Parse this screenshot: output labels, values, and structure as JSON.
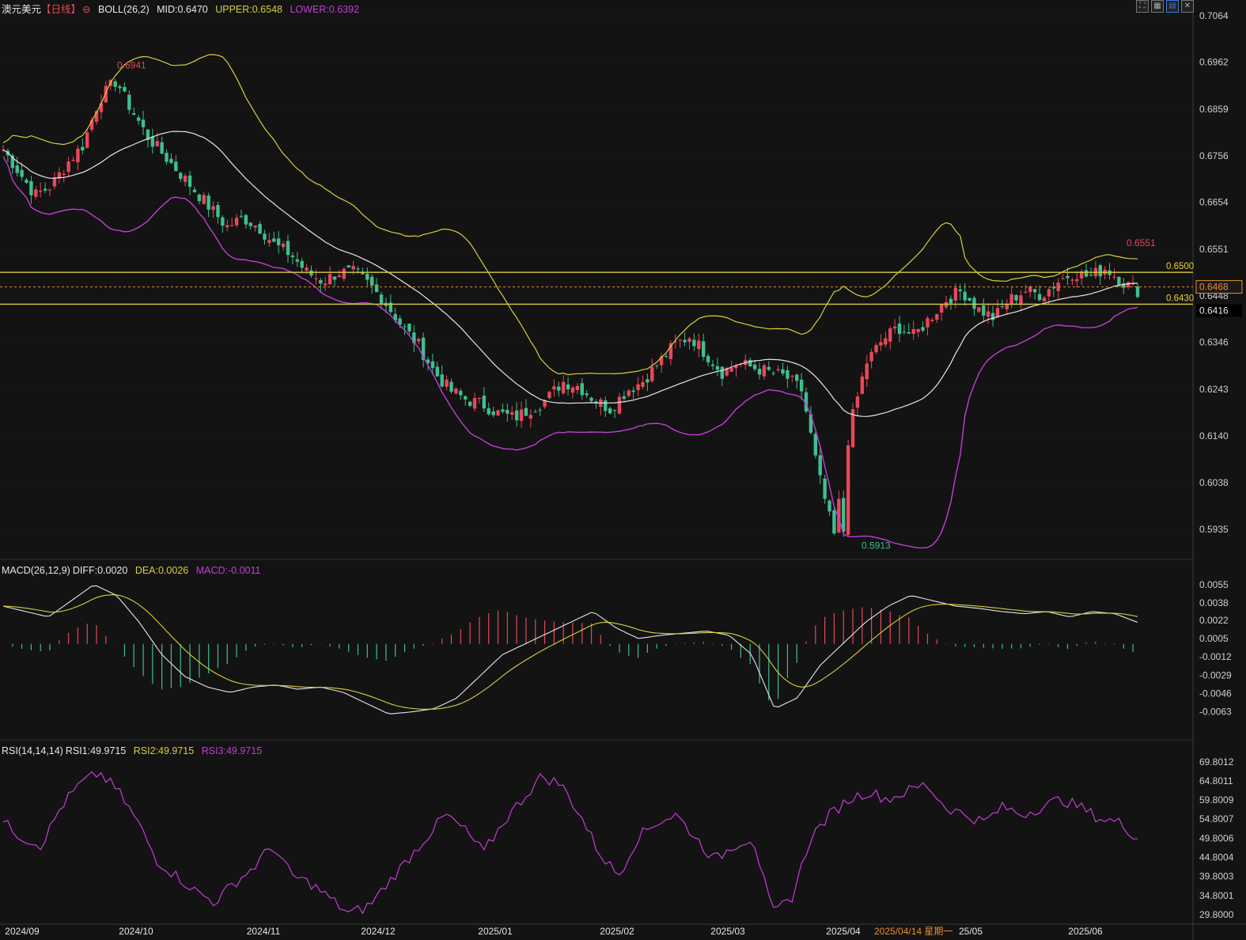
{
  "header": {
    "symbol": "澳元美元",
    "period": "【日线】",
    "indicator": "BOLL(26,2)",
    "mid": "MID:0.6470",
    "upper": "UPPER:0.6548",
    "lower": "LOWER:0.6392"
  },
  "toolbar_icons": [
    "fullscreen-icon",
    "grid-icon",
    "layout-icon",
    "close-icon"
  ],
  "colors": {
    "up": "#e8475a",
    "down": "#3fbf8f",
    "mid": "#e6e6e6",
    "upper": "#d8cf3a",
    "lower": "#c43cd6",
    "rsi": "#c43cd6"
  },
  "macd_header": {
    "title": "MACD(26,12,9)",
    "diff": "DIFF:0.0020",
    "dea": "DEA:0.0026",
    "macd": "MACD:-0.0011"
  },
  "rsi_header": {
    "title": "RSI(14,14,14)",
    "rsi1": "RSI1:49.9715",
    "rsi2": "RSI2:49.9715",
    "rsi3": "RSI3:49.9715"
  },
  "chart_data": {
    "type": "candlestick",
    "price_axis": {
      "ticks": [
        "0.7064",
        "0.6962",
        "0.6859",
        "0.6756",
        "0.6654",
        "0.6551",
        "0.6448",
        "0.6346",
        "0.6243",
        "0.6140",
        "0.6038",
        "0.5935"
      ],
      "ylim": [
        0.5895,
        0.7064
      ]
    },
    "macd_axis": {
      "ticks": [
        "0.0055",
        "0.0038",
        "0.0022",
        "0.0005",
        "-0.0012",
        "-0.0029",
        "-0.0046",
        "-0.0063"
      ]
    },
    "rsi_axis": {
      "ticks": [
        "69.8012",
        "64.8011",
        "59.8009",
        "54.8007",
        "49.8006",
        "44.8004",
        "39.8003",
        "34.8001",
        "29.8000"
      ]
    },
    "x_labels": [
      "2024/09",
      "2024/10",
      "2024/11",
      "2024/12",
      "2025/01",
      "2025/02",
      "2025/03",
      "2025/04",
      "25/05",
      "2025/06"
    ],
    "cursor_label": "2025/04/14 星期一",
    "horizontal_lines": [
      {
        "value": 0.65,
        "label": "0.6500"
      },
      {
        "value": 0.643,
        "label": "0.6430"
      }
    ],
    "current_price": "0.6468",
    "cursor_price": "0.6416",
    "annotations": {
      "high": "0.6941",
      "low": "0.5913",
      "recent_high": "0.6551"
    },
    "close_anchors": [
      0.677,
      0.672,
      0.667,
      0.669,
      0.674,
      0.678,
      0.688,
      0.692,
      0.686,
      0.68,
      0.676,
      0.672,
      0.668,
      0.664,
      0.66,
      0.662,
      0.66,
      0.656,
      0.654,
      0.65,
      0.648,
      0.65,
      0.65,
      0.647,
      0.643,
      0.638,
      0.634,
      0.628,
      0.624,
      0.622,
      0.621,
      0.619,
      0.618,
      0.62,
      0.622,
      0.626,
      0.625,
      0.622,
      0.62,
      0.624,
      0.626,
      0.63,
      0.634,
      0.636,
      0.632,
      0.628,
      0.63,
      0.629,
      0.628,
      0.627,
      0.624,
      0.606,
      0.592,
      0.616,
      0.63,
      0.635,
      0.638,
      0.636,
      0.64,
      0.644,
      0.646,
      0.642,
      0.64,
      0.644,
      0.646,
      0.645,
      0.648,
      0.65,
      0.649,
      0.651,
      0.648,
      0.646
    ],
    "macd_anchors": [
      0.0035,
      0.003,
      0.0025,
      0.004,
      0.0055,
      0.0045,
      0.002,
      -0.001,
      -0.003,
      -0.004,
      -0.0045,
      -0.004,
      -0.0038,
      -0.0042,
      -0.004,
      -0.0045,
      -0.0055,
      -0.0065,
      -0.0063,
      -0.006,
      -0.005,
      -0.003,
      -0.001,
      0.0,
      0.001,
      0.002,
      0.003,
      0.0015,
      0.0005,
      0.0008,
      0.001,
      0.0012,
      0.0008,
      -0.001,
      -0.006,
      -0.005,
      -0.002,
      0.0,
      0.002,
      0.0035,
      0.0045,
      0.004,
      0.0035,
      0.0033,
      0.003,
      0.0028,
      0.003,
      0.0025,
      0.003,
      0.0028,
      0.002
    ],
    "rsi_anchors": [
      54,
      50,
      48,
      58,
      64,
      67,
      62,
      54,
      44,
      40,
      36,
      33,
      38,
      42,
      48,
      40,
      38,
      34,
      30,
      32,
      38,
      44,
      50,
      56,
      52,
      46,
      54,
      60,
      66,
      64,
      56,
      46,
      40,
      50,
      54,
      56,
      50,
      44,
      48,
      50,
      30,
      34,
      50,
      56,
      60,
      62,
      60,
      62,
      64,
      58,
      56,
      54,
      58,
      56,
      58,
      60,
      58,
      55,
      54,
      50
    ]
  }
}
